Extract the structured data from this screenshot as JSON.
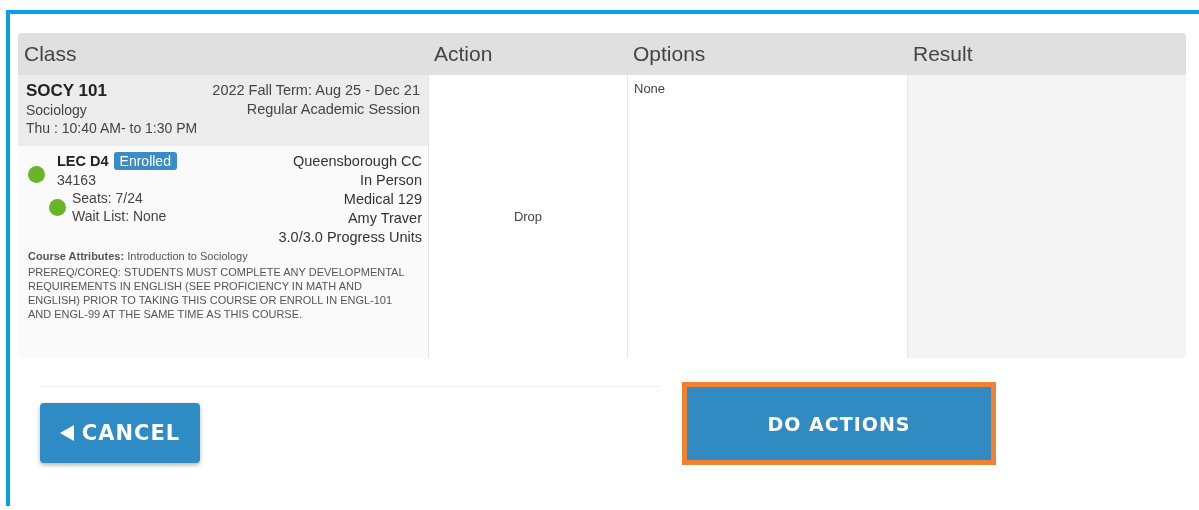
{
  "table": {
    "columns": [
      "Class",
      "Action",
      "Options",
      "Result"
    ],
    "rows": [
      {
        "class": {
          "code": "SOCY 101",
          "title": "Sociology",
          "meeting": "Thu : 10:40 AM- to 1:30 PM",
          "term": "2022 Fall Term: Aug 25 - Dec 21",
          "session": "Regular Academic Session",
          "section": {
            "name": "LEC D4",
            "status_dot": {
              "color": "#6ab42a"
            },
            "badge": "Enrolled",
            "number": "34163",
            "seats_dot": {
              "color": "#6ab42a"
            },
            "seats": "Seats: 7/24",
            "wait_list": "Wait List: None",
            "details": [
              "Queensborough CC",
              "In Person",
              "Medical 129",
              "Amy Traver",
              "3.0/3.0 Progress Units"
            ],
            "attributes_label": "Course Attributes:",
            "attributes_text": " Introduction to Sociology",
            "notes": "PREREQ/COREQ: STUDENTS MUST COMPLETE ANY DEVELOPMENTAL REQUIREMENTS IN ENGLISH (SEE PROFICIENCY IN MATH AND ENGLISH) PRIOR TO TAKING THIS COURSE OR ENROLL IN ENGL-101 AND ENGL-99 AT THE SAME TIME AS THIS COURSE."
          }
        },
        "action": "Drop",
        "options": "None"
      }
    ]
  },
  "buttons": {
    "cancel": "CANCEL",
    "do_actions": {
      "label": "DO ACTIONS",
      "highlighted": true
    }
  }
}
